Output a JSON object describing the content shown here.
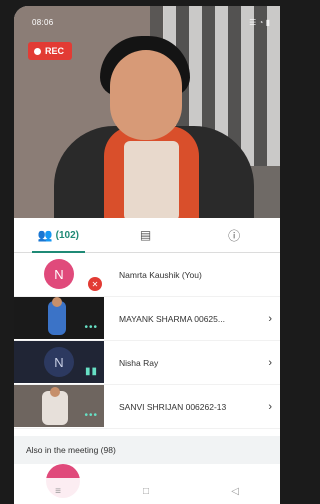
{
  "status_bar": {
    "time": "08:06",
    "icons": "▪ ⚙",
    "right": "☰ ◔ ▮"
  },
  "rec": {
    "label": "REC"
  },
  "tabs": [
    {
      "label": "(102)",
      "icon": "people-icon",
      "active": true
    },
    {
      "label": "",
      "icon": "chat-icon",
      "active": false
    },
    {
      "label": "",
      "icon": "info-icon",
      "active": false
    }
  ],
  "participants": [
    {
      "name": "Namrta Kaushik (You)",
      "avatar": "N",
      "muted": true,
      "has_chevron": false
    },
    {
      "name": "MAYANK SHARMA 00625...",
      "avatar": "",
      "muted": false,
      "has_chevron": true
    },
    {
      "name": "Nisha Ray",
      "avatar": "N",
      "muted": false,
      "has_chevron": true
    },
    {
      "name": "SANVI SHRIJAN 006262-13",
      "avatar": "",
      "muted": false,
      "has_chevron": true
    }
  ],
  "section": {
    "title": "Also in the meeting (98)"
  },
  "nav": {
    "menu": "≡",
    "home": "□",
    "back": "◁"
  }
}
